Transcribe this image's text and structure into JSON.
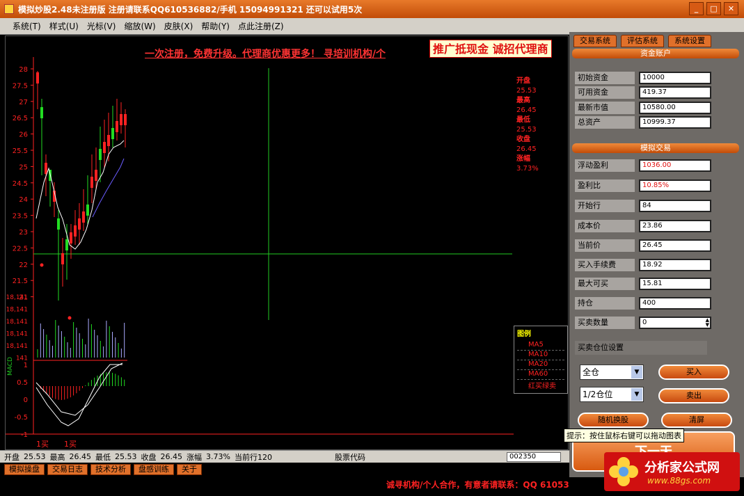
{
  "window": {
    "title": "模拟炒股2.48未注册版 注册请联系QQ610536882/手机 15094991321 还可以试用5次"
  },
  "menu": [
    "系统(T)",
    "样式(U)",
    "光标(V)",
    "缩放(W)",
    "皮肤(X)",
    "帮助(Y)",
    "点此注册(Z)"
  ],
  "chart": {
    "banner": "一次注册，免费升级。代理商优惠更多！ 寻培训机构/个",
    "promo": "推广抵现金",
    "promo2": "诚招代理商",
    "ohlc": [
      {
        "label": "开盘",
        "value": "25.53"
      },
      {
        "label": "最高",
        "value": "26.45"
      },
      {
        "label": "最低",
        "value": "25.53"
      },
      {
        "label": "收盘",
        "value": "26.45"
      },
      {
        "label": "涨幅",
        "value": "3.73%"
      }
    ],
    "y_ticks": [
      "28",
      "27.5",
      "27",
      "26.5",
      "26",
      "25.5",
      "25",
      "24.5",
      "24",
      "23.5",
      "23",
      "22.5",
      "22",
      "21.5",
      "21"
    ],
    "vol_ticks": [
      "18,141",
      "18,141",
      "18,141",
      "18,141",
      "18,141",
      "141"
    ],
    "macd_ticks": [
      "1",
      "0.5",
      "0",
      "-0.5",
      "-1"
    ],
    "macd_label": "MACD",
    "x_marks": [
      "1买",
      "1买"
    ],
    "legend": {
      "title": "图例",
      "items": [
        "MA5",
        "MA10",
        "MA20",
        "MA60",
        "红买绿卖"
      ]
    }
  },
  "infobar": {
    "open_l": "开盘",
    "open": "25.53",
    "high_l": "最高",
    "high": "26.45",
    "low_l": "最低",
    "low": "25.53",
    "close_l": "收盘",
    "close": "26.45",
    "chg_l": "涨幅",
    "chg": "3.73%",
    "row_l": "当前行120",
    "code_l": "股票代码",
    "code": "002350"
  },
  "bottom_tabs": [
    "模拟操盘",
    "交易日志",
    "技术分析",
    "盘感训练",
    "关于"
  ],
  "status_text": "诚寻机构/个人合作，有意者请联系：QQ 61053",
  "panel": {
    "tabs": [
      "交易系统",
      "评估系统",
      "系统设置"
    ],
    "account_title": "资金账户",
    "account": [
      {
        "k": "初始资金",
        "v": "10000"
      },
      {
        "k": "可用资金",
        "v": "419.37"
      },
      {
        "k": "最新市值",
        "v": "10580.00"
      },
      {
        "k": "总资产",
        "v": "10999.37"
      }
    ],
    "trade_title": "模拟交易",
    "trade": [
      {
        "k": "浮动盈利",
        "v": "1036.00",
        "red": true
      },
      {
        "k": "盈利比",
        "v": "10.85%",
        "red": true
      },
      {
        "k": "开始行",
        "v": "84"
      },
      {
        "k": "成本价",
        "v": "23.86"
      },
      {
        "k": "当前价",
        "v": "26.45"
      },
      {
        "k": "买入手续费",
        "v": "18.92"
      },
      {
        "k": "最大可买",
        "v": "15.81"
      },
      {
        "k": "持仓",
        "v": "400"
      }
    ],
    "qty_label": "买卖数量",
    "qty": "0",
    "pos_label": "买卖仓位设置",
    "sel1": "全仓",
    "sel2": "1/2仓位",
    "buy": "买入",
    "sell": "卖出",
    "random": "随机换股",
    "clear": "清屏",
    "next": "下一天"
  },
  "tooltip": "提示：按住鼠标右键可以拖动图表",
  "logo": {
    "name": "分析家公式网",
    "url": "www.88gs.com"
  }
}
